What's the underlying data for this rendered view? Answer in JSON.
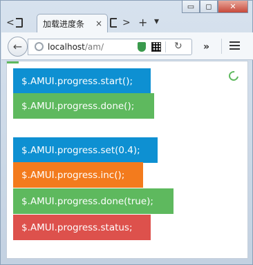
{
  "window": {
    "minimize": "▭",
    "maximize": "◻",
    "close": "✕"
  },
  "tabs": {
    "back_arrow": "<",
    "title": "加载进度条",
    "close": "×",
    "forward_arrow": ">",
    "new_tab": "+",
    "dropdown": "▾"
  },
  "toolbar": {
    "back": "←",
    "url_host": "localhost",
    "url_path": "/am/",
    "reload": "↻",
    "overflow": "»"
  },
  "page": {
    "progress_fraction": 0.05,
    "buttons": [
      {
        "label": "$.AMUI.progress.start();",
        "color": "#0e90d2"
      },
      {
        "label": "$.AMUI.progress.done();",
        "color": "#5eb95e"
      },
      {
        "label": "$.AMUI.progress.set(0.4);",
        "color": "#0e90d2"
      },
      {
        "label": "$.AMUI.progress.inc();",
        "color": "#f37b1d"
      },
      {
        "label": "$.AMUI.progress.done(true);",
        "color": "#5eb95e"
      },
      {
        "label": "$.AMUI.progress.status;",
        "color": "#dd514c"
      }
    ]
  }
}
